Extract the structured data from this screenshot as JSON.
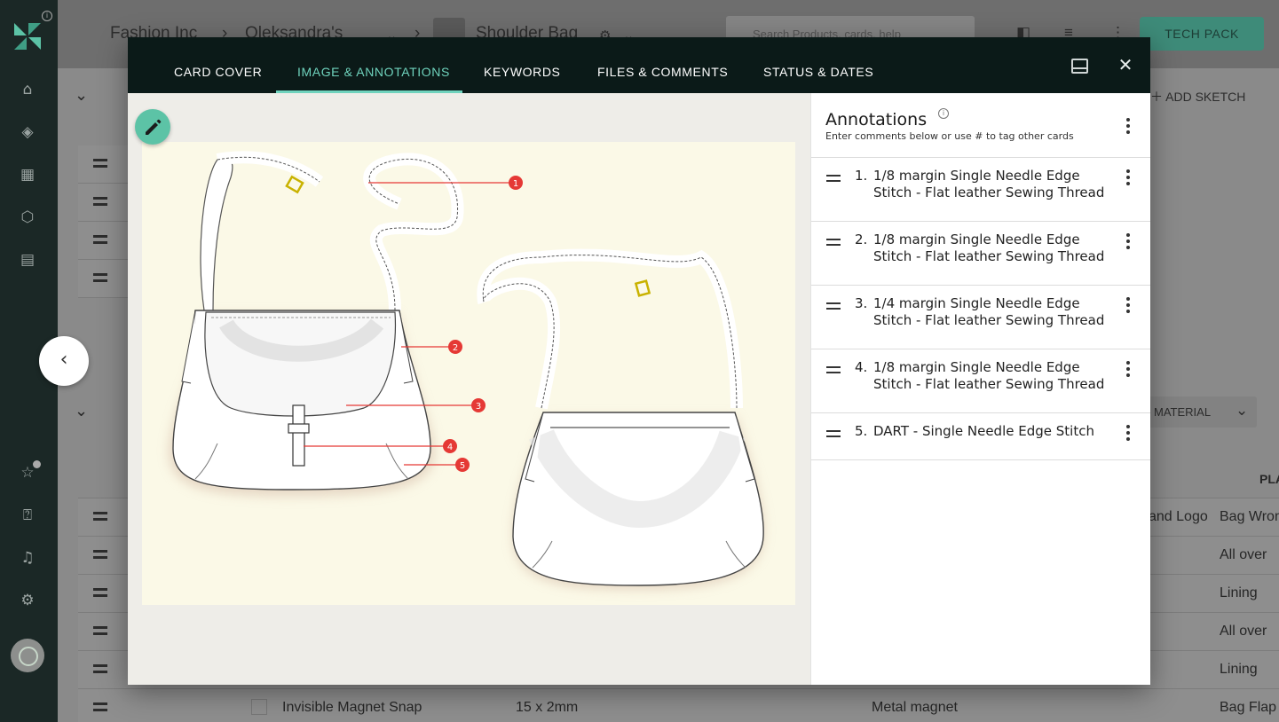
{
  "app": {
    "breadcrumb": [
      "Fashion Inc",
      "Oleksandra's",
      "Shoulder Bag"
    ],
    "search_placeholder": "Search Products, cards, help",
    "tech_pack_label": "TECH PACK",
    "add_sketch_label": "ADD SKETCH",
    "material_label": "MATERIAL",
    "table_header_partial": "PLA"
  },
  "background_rows": [
    {
      "name": "",
      "size": "",
      "material": "and Logo",
      "placement": "Bag Wron"
    },
    {
      "name": "",
      "size": "",
      "material": "",
      "placement": "All over"
    },
    {
      "name": "",
      "size": "",
      "material": "",
      "placement": "Lining"
    },
    {
      "name": "",
      "size": "",
      "material": "",
      "placement": "All over"
    },
    {
      "name": "",
      "size": "",
      "material": "",
      "placement": "Lining"
    },
    {
      "name": "Invisible Magnet Snap",
      "size": "15 x 2mm",
      "material": "Metal magnet",
      "placement": "Bag Flap"
    }
  ],
  "modal": {
    "tabs": [
      {
        "label": "CARD COVER",
        "active": false
      },
      {
        "label": "IMAGE & ANNOTATIONS",
        "active": true
      },
      {
        "label": "KEYWORDS",
        "active": false
      },
      {
        "label": "FILES & COMMENTS",
        "active": false
      },
      {
        "label": "STATUS & DATES",
        "active": false
      }
    ],
    "accent_color": "#6fd3bd"
  },
  "annotations": {
    "title": "Annotations",
    "subtitle": "Enter comments below or use # to tag other cards",
    "items": [
      {
        "num": "1.",
        "text": "1/8 margin Single Needle Edge Stitch - Flat leather Sewing Thread"
      },
      {
        "num": "2.",
        "text": "1/8 margin Single Needle Edge Stitch - Flat leather Sewing Thread"
      },
      {
        "num": "3.",
        "text": "1/4 margin Single Needle Edge Stitch - Flat leather Sewing Thread"
      },
      {
        "num": "4.",
        "text": "1/8 margin Single Needle Edge Stitch - Flat leather Sewing Thread"
      },
      {
        "num": "5.",
        "text": "DART - Single Needle Edge Stitch"
      }
    ]
  },
  "sketch_markers": [
    "1",
    "2",
    "3",
    "4",
    "5"
  ],
  "marker_color": "#e53935"
}
